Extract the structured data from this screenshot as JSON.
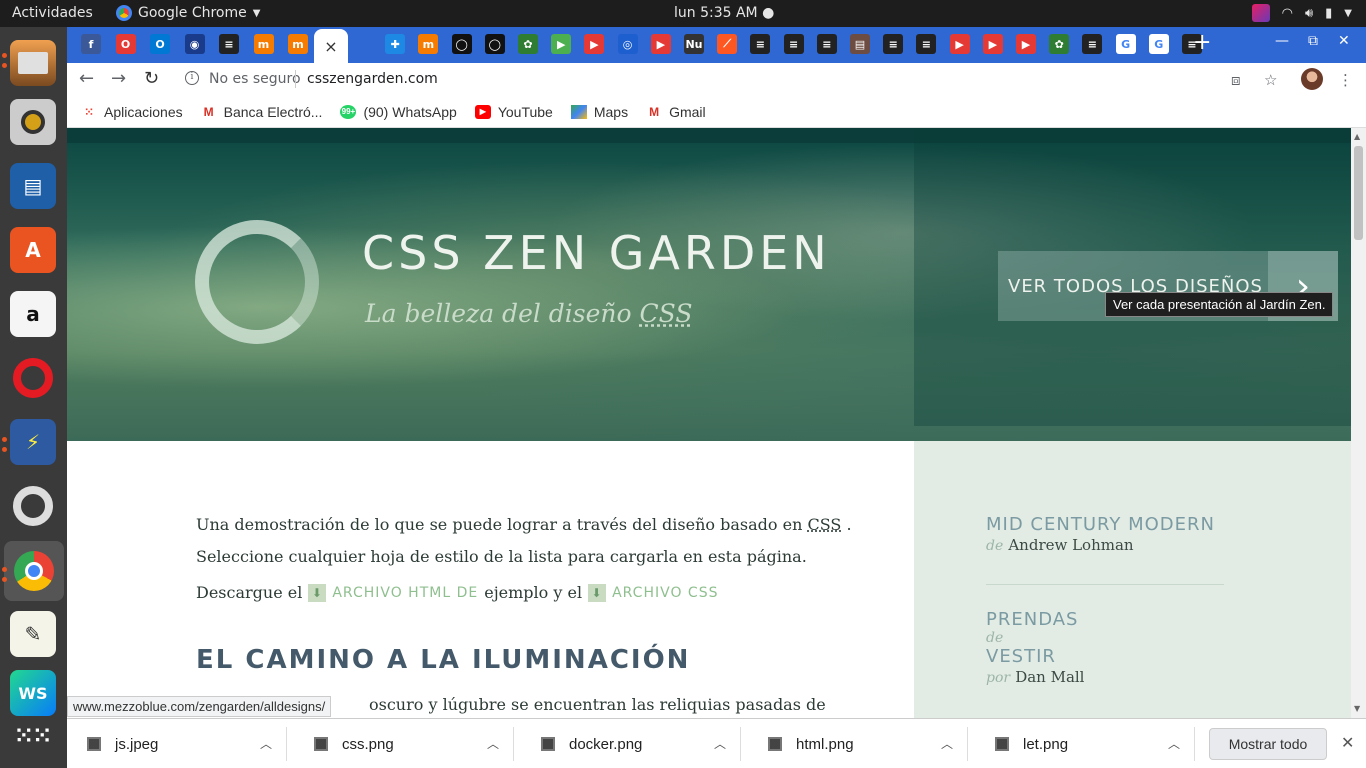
{
  "topbar": {
    "activities": "Actividades",
    "app_name": "Google Chrome",
    "clock": "lun   5:35 AM ●"
  },
  "dock": {
    "apps": [
      "files-icon",
      "speaker-icon",
      "libreoffice-impress-icon",
      "software-center-icon",
      "amazon-icon",
      "opera-icon",
      "network-icon",
      "opera-gx-icon",
      "chrome-icon",
      "text-editor-icon",
      "webstorm-icon",
      "app-grid-icon"
    ]
  },
  "tabs": {
    "favicons": [
      "f",
      "O",
      "O",
      "◉",
      "≡",
      "m",
      "m",
      "",
      "✚",
      "m",
      "◯",
      "◯",
      "✿",
      "▶",
      "▶",
      "◎",
      "▶",
      "Nu",
      "⟋",
      "≡",
      "≡",
      "≡",
      "▤",
      "≡",
      "≡",
      "▶",
      "▶",
      "▶",
      "✿",
      "≡",
      "G",
      "G",
      "≡"
    ],
    "colors": [
      "#3b5998",
      "#e53935",
      "#0078d4",
      "#1a3a8a",
      "#222",
      "#f57c00",
      "#f57c00",
      "#fff",
      "#1e88e5",
      "#f57c00",
      "#111",
      "#111",
      "#2e7d32",
      "#4caf50",
      "#e53935",
      "#1e5fcf",
      "#e53935",
      "#333",
      "#ff5722",
      "#222",
      "#222",
      "#222",
      "#6d4c41",
      "#222",
      "#222",
      "#e53935",
      "#e53935",
      "#e53935",
      "#2e7d32",
      "#222",
      "#fff",
      "#fff",
      "#222"
    ],
    "close_label": "×",
    "new_tab_label": "+"
  },
  "toolbar": {
    "security_label": "No es seguro",
    "url": "csszengarden.com"
  },
  "bookmarks": [
    {
      "label": "Aplicaciones",
      "icon": "apps-grid-icon"
    },
    {
      "label": "Banca Electró...",
      "icon": "gmail-icon"
    },
    {
      "label": "(90) WhatsApp",
      "icon": "whatsapp-icon"
    },
    {
      "label": "YouTube",
      "icon": "youtube-icon"
    },
    {
      "label": "Maps",
      "icon": "maps-icon"
    },
    {
      "label": "Gmail",
      "icon": "gmail-icon"
    }
  ],
  "page": {
    "title": "CSS ZEN GARDEN",
    "subtitle_prefix": "La belleza del diseño ",
    "subtitle_abbr": "CSS",
    "all_designs_label": "VER TODOS LOS DISEÑOS",
    "tooltip": "Ver cada presentación al Jardín Zen.",
    "intro_1": "Una demostración de lo que se puede lograr a través del diseño basado en ",
    "intro_abbr": "CSS",
    "intro_2": " . Seleccione cualquier hoja de estilo de la lista para cargarla en esta página.",
    "download_prefix": "Descargue el",
    "download_html": "ARCHIVO HTML DE",
    "download_mid": "ejemplo y el",
    "download_css": "ARCHIVO CSS",
    "section_heading": "EL CAMINO A LA ILUMINACIÓN",
    "body_fragment": "oscuro y lúgubre se encuentran las reliquias pasadas de",
    "designs": [
      {
        "name": "MID CENTURY MODERN",
        "by": "de",
        "author": "Andrew Lohman"
      },
      {
        "name_1": "PRENDAS",
        "by_mid": "de",
        "name_2": "VESTIR",
        "by": "por",
        "author": "Dan Mall"
      }
    ]
  },
  "status_url": "www.mezzoblue.com/zengarden/alldesigns/",
  "downloads": {
    "files": [
      "js.jpeg",
      "css.png",
      "docker.png",
      "html.png",
      "let.png"
    ],
    "show_all": "Mostrar todo"
  }
}
